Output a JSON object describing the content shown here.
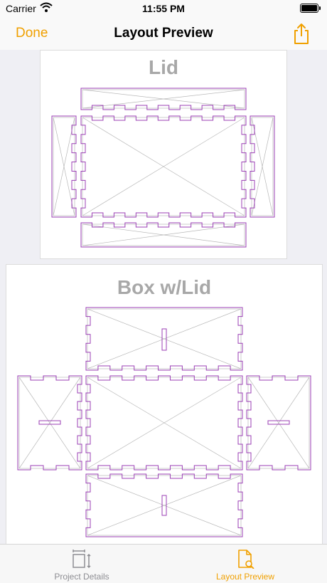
{
  "status_bar": {
    "carrier": "Carrier",
    "time": "11:55 PM",
    "icons": [
      "wifi-icon",
      "battery-icon"
    ]
  },
  "nav": {
    "done_label": "Done",
    "title": "Layout Preview",
    "share_icon": "share-icon",
    "accent_color": "#f0a000"
  },
  "layouts": [
    {
      "title": "Lid"
    },
    {
      "title": "Box w/Lid"
    }
  ],
  "colors": {
    "panel_outline": "#9b3fb5",
    "guide_lines": "#b8b8b8",
    "title_gray": "#a8a8a8"
  },
  "tabs": [
    {
      "label": "Project Details",
      "icon": "resize-icon",
      "selected": false
    },
    {
      "label": "Layout Preview",
      "icon": "document-search-icon",
      "selected": true
    }
  ]
}
